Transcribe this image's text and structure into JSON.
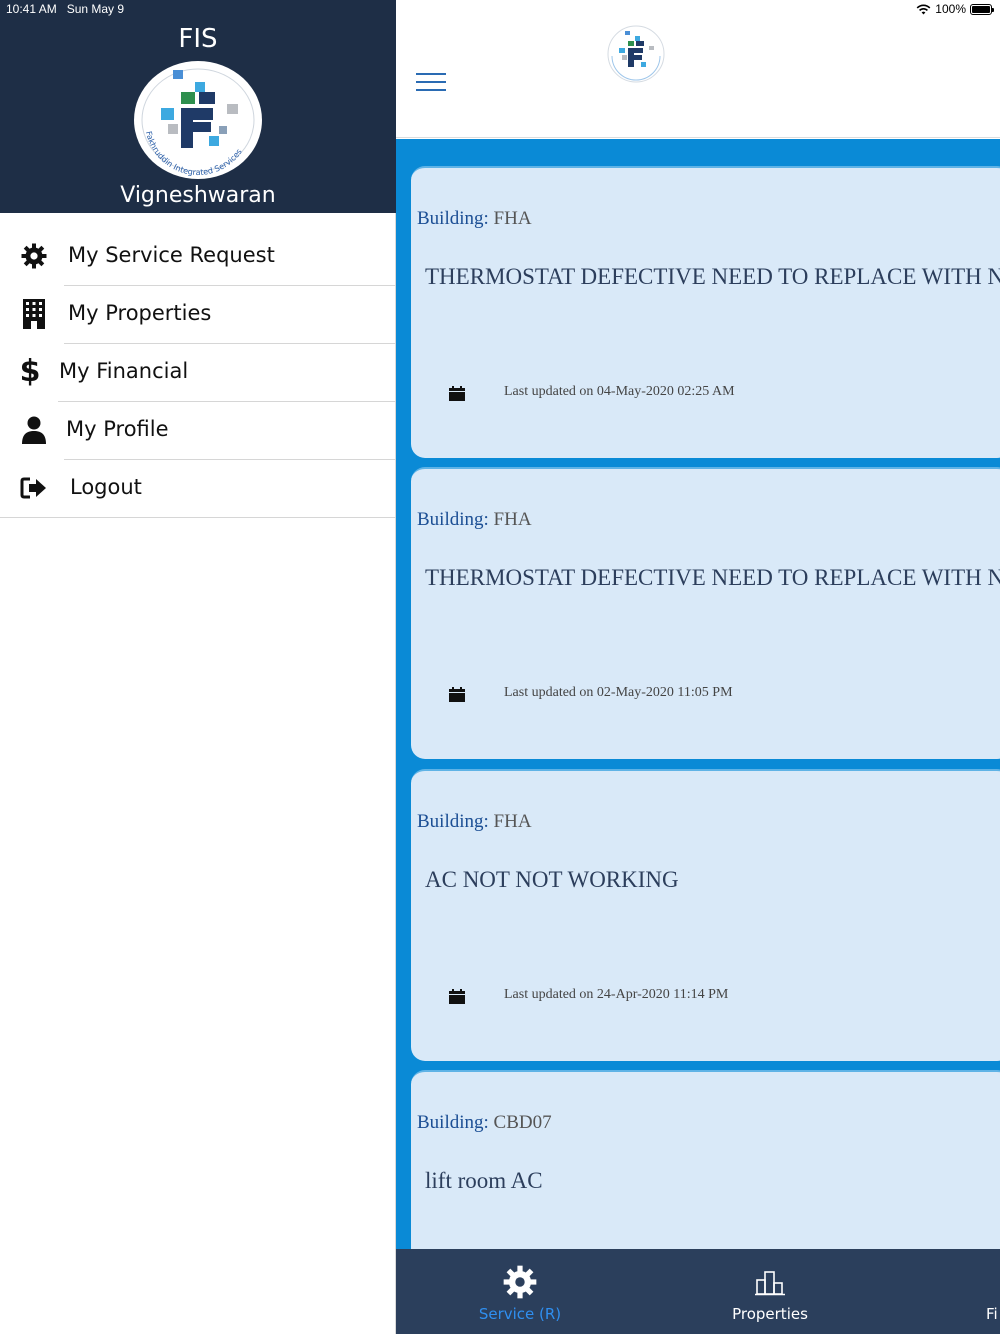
{
  "status_bar": {
    "time": "10:41 AM",
    "date": "Sun May 9",
    "battery": "100%"
  },
  "drawer": {
    "title": "FIS",
    "logo_text": "Fakhruddin Integrated Services",
    "user_name": "Vigneshwaran",
    "items": [
      {
        "label": "My Service Request",
        "icon": "gear-icon"
      },
      {
        "label": "My Properties",
        "icon": "building-icon"
      },
      {
        "label": "My Financial",
        "icon": "dollar-icon"
      },
      {
        "label": "My Profile",
        "icon": "user-icon"
      },
      {
        "label": "Logout",
        "icon": "logout-icon"
      }
    ]
  },
  "requests": [
    {
      "building_label": "Building:",
      "building": "FHA",
      "description": "THERMOSTAT DEFECTIVE NEED TO REPLACE WITH NEW",
      "updated": "Last updated on 04-May-2020 02:25 AM"
    },
    {
      "building_label": "Building:",
      "building": "FHA",
      "description": "THERMOSTAT DEFECTIVE NEED TO REPLACE WITH NEW",
      "updated": "Last updated on 02-May-2020 11:05 PM"
    },
    {
      "building_label": "Building:",
      "building": "FHA",
      "description": "AC NOT NOT WORKING",
      "updated": "Last updated on 24-Apr-2020 11:14 PM"
    },
    {
      "building_label": "Building:",
      "building": "CBD07",
      "description": "lift room AC",
      "updated": ""
    }
  ],
  "tabs": [
    {
      "label": "Service (R)",
      "icon": "gear-icon",
      "active": true
    },
    {
      "label": "Properties",
      "icon": "bar-chart-icon",
      "active": false
    },
    {
      "label": "Fi",
      "icon": "",
      "active": false
    }
  ],
  "colors": {
    "header": "#1e2e46",
    "list_bg": "#0a8ad6",
    "card": "#d9e9f8",
    "tabbar": "#2b3f5c",
    "active_tab": "#2f8ff0"
  }
}
